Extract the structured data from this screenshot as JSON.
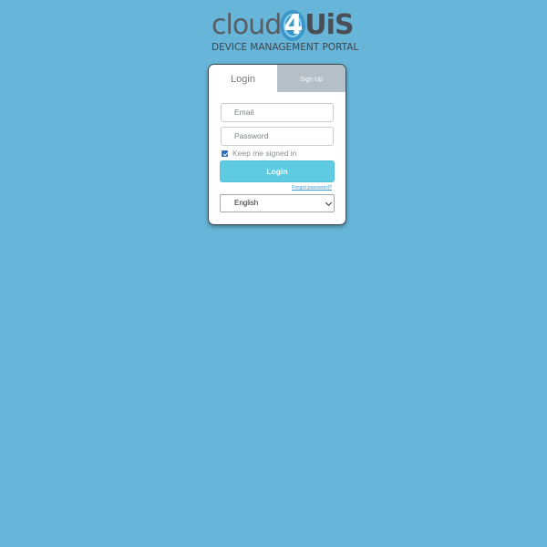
{
  "logo": {
    "part_cloud": "cloud",
    "part_four": "4",
    "part_uis": "UiS",
    "subtitle": "DEVICE MANAGEMENT PORTAL"
  },
  "tabs": {
    "login": "Login",
    "signup": "Sign Up"
  },
  "form": {
    "email_placeholder": "Email",
    "password_placeholder": "Password",
    "remember_label": "Keep me signed in",
    "remember_checked": true,
    "login_button": "Login",
    "forgot_link": "Forgot password?",
    "language_selected": "English"
  },
  "colors": {
    "background": "#67b5d9",
    "login_button": "#5fcbe3",
    "signup_tab": "#b4bfc7",
    "link": "#3a9ad6"
  }
}
